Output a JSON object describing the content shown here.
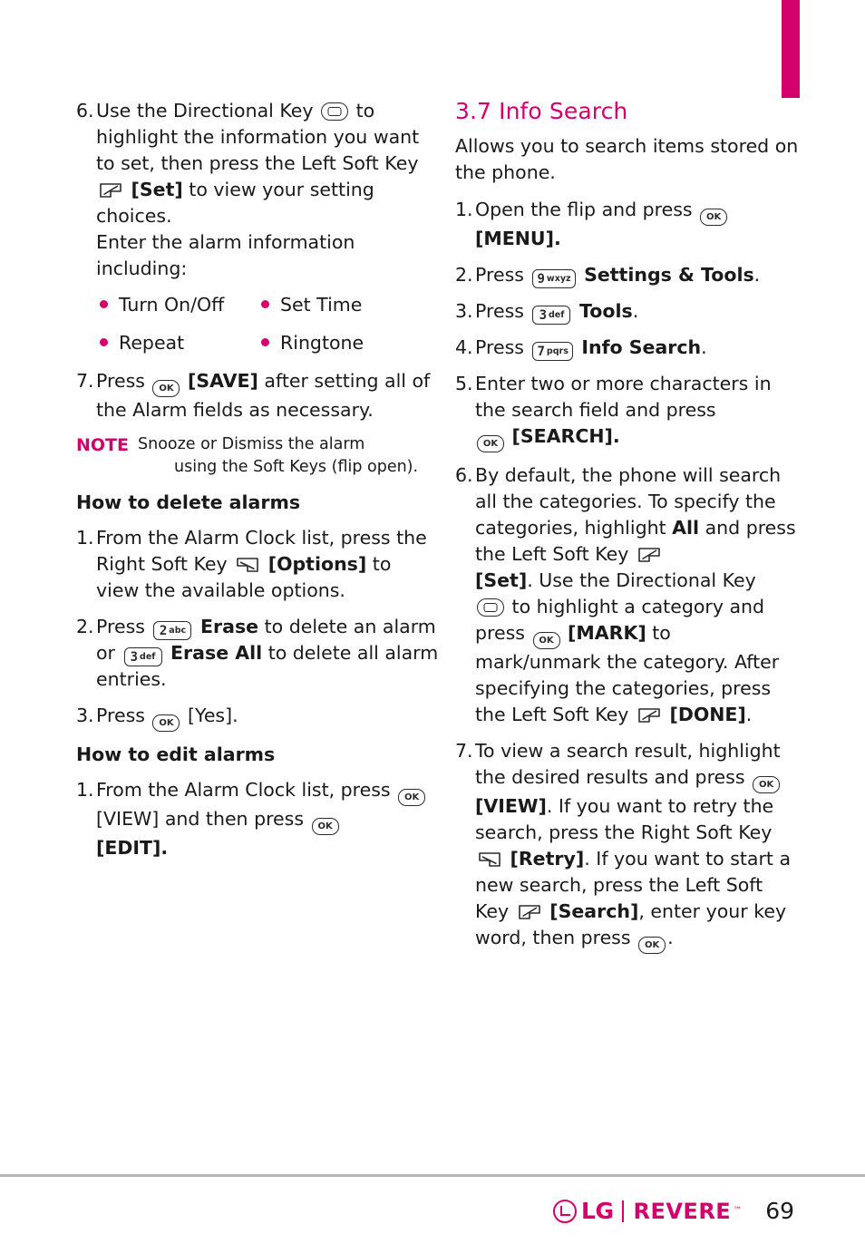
{
  "page": {
    "number": "69",
    "brand": "LG",
    "model": "REVERE",
    "trademark": "™"
  },
  "left_column": {
    "step6": {
      "num": "6.",
      "part1": "Use the Directional Key",
      "part2": "to highlight  the information you want to set, then press the Left Soft Key",
      "part3": "[Set]",
      "part4": "to view your setting choices.",
      "part5": "Enter the alarm information including:"
    },
    "bullets": [
      {
        "left": "Turn On/Off",
        "right": "Set Time"
      },
      {
        "left": "Repeat",
        "right": "Ringtone"
      }
    ],
    "step7": {
      "num": "7.",
      "part1": "Press",
      "part2": "[SAVE]",
      "part3": "after setting all of the Alarm fields as necessary."
    },
    "note": {
      "label": "NOTE",
      "line1": "Snooze or Dismiss the alarm",
      "line2": "using the Soft Keys (flip open)."
    },
    "heading_delete": "How to delete alarms",
    "delete_steps": [
      {
        "num": "1.",
        "part1": "From the Alarm Clock list, press the Right Soft Key",
        "part2": "[Options]",
        "part3": "to view the available options."
      },
      {
        "num": "2.",
        "part1": "Press",
        "key1_digit": "2",
        "key1_letters": "abc",
        "part2": "Erase",
        "part3": "to delete an alarm or",
        "key2_digit": "3",
        "key2_letters": "def",
        "part4": "Erase All",
        "part5": "to delete all alarm entries."
      },
      {
        "num": "3.",
        "part1": "Press",
        "part2": "[Yes]",
        "part3": "."
      }
    ],
    "heading_edit": "How to edit alarms",
    "edit_steps": [
      {
        "num": "1.",
        "part1": "From the Alarm Clock list, press",
        "part2": "[VIEW]",
        "part3": "and then press",
        "part4": "[EDIT]."
      }
    ]
  },
  "right_column": {
    "section_title": "3.7 Info Search",
    "intro": "Allows you to search items stored on the phone.",
    "steps": [
      {
        "num": "1.",
        "part1": "Open the flip and press",
        "part2": "[MENU]."
      },
      {
        "num": "2.",
        "part1": "Press",
        "key_digit": "9",
        "key_letters": "wxyz",
        "part2": "Settings & Tools",
        "part3": "."
      },
      {
        "num": "3.",
        "part1": "Press",
        "key_digit": "3",
        "key_letters": "def",
        "part2": "Tools",
        "part3": "."
      },
      {
        "num": "4.",
        "part1": "Press",
        "key_digit": "7",
        "key_letters": "pqrs",
        "part2": "Info Search",
        "part3": "."
      },
      {
        "num": "5.",
        "part1": "Enter two or more characters in the search field and press",
        "part2": "[SEARCH]."
      },
      {
        "num": "6.",
        "part1": "By default, the phone will search all the categories. To specify the categories, highlight",
        "bold1": "All",
        "part2": "and press the Left Soft Key",
        "bold2": "[Set]",
        "part3": ". Use the Directional Key",
        "part4": "to highlight a category and press",
        "bold3": "[MARK]",
        "part5": "to mark/unmark the category. After specifying the categories, press the Left Soft Key",
        "bold4": "[DONE]",
        "part6": "."
      },
      {
        "num": "7.",
        "part1": "To view a search result, highlight the desired results and press",
        "bold1": "[VIEW]",
        "part2": ". If you want to retry the search, press the Right Soft Key",
        "bold2": "[Retry]",
        "part3": ". If you want to start a new search, press the Left Soft Key",
        "bold3": "[Search]",
        "part4": ", enter your key word, then press",
        "part5": "."
      }
    ]
  },
  "icons": {
    "ok_key": "ok-key-icon",
    "directional_key": "directional-key-icon",
    "left_soft_key": "left-soft-key-icon",
    "right_soft_key": "right-soft-key-icon"
  }
}
